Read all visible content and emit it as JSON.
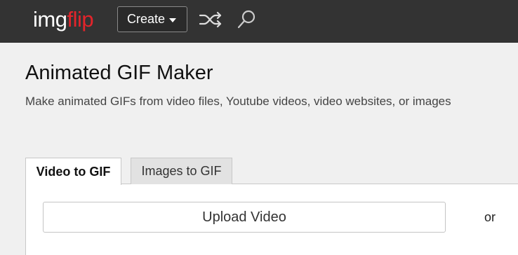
{
  "header": {
    "logo_img": "img",
    "logo_flip": "flip",
    "create_label": "Create",
    "shuffle_icon": "shuffle-icon",
    "search_icon": "search-icon",
    "colors": {
      "bar": "#333333",
      "logo_accent": "#e3242b"
    }
  },
  "main": {
    "title": "Animated GIF Maker",
    "subtitle": "Make animated GIFs from video files, Youtube videos, video websites, or images",
    "tabs": [
      {
        "label": "Video to GIF",
        "active": true
      },
      {
        "label": "Images to GIF",
        "active": false
      }
    ],
    "upload_label": "Upload Video",
    "or_label": "or"
  }
}
